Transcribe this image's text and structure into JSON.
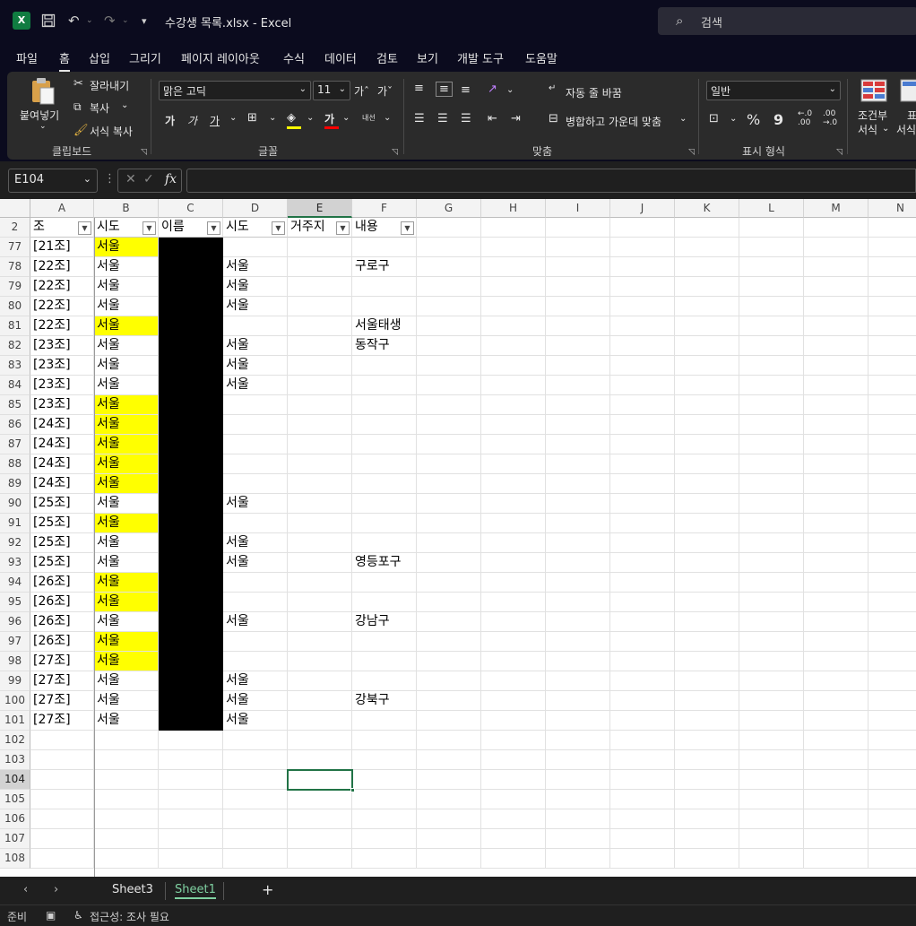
{
  "window": {
    "title": "수강생 목록.xlsx  -  Excel",
    "search_placeholder": "검색"
  },
  "menu": [
    "파일",
    "홈",
    "삽입",
    "그리기",
    "페이지 레이아웃",
    "수식",
    "데이터",
    "검토",
    "보기",
    "개발 도구",
    "도움말"
  ],
  "menu_active": "홈",
  "ribbon": {
    "clipboard": {
      "label": "클립보드",
      "paste": "붙여넣기",
      "cut": "잘라내기",
      "copy": "복사",
      "format_painter": "서식 복사"
    },
    "font": {
      "label": "글꼴",
      "font_name": "맑은 고딕",
      "font_size": "11",
      "grow": "가ˆ",
      "shrink": "가ˇ",
      "bold": "가",
      "italic": "가",
      "underline": "가",
      "font_color_glyph": "가",
      "phonetic": "내선"
    },
    "alignment": {
      "label": "맞춤",
      "wrap_text": "자동 줄 바꿈",
      "merge_center": "병합하고 가운데 맞춤"
    },
    "number": {
      "label": "표시 형식",
      "format": "일반",
      "percent": "%",
      "comma": "9",
      "inc_decimal": "←.0\n.00",
      "dec_decimal": ".00\n→.0"
    },
    "styles": {
      "conditional_line1": "조건부",
      "conditional_line2": "서식",
      "table_line1": "표",
      "table_line2": "서식"
    }
  },
  "formula_bar": {
    "name_box": "E104",
    "fx": "fx",
    "content": ""
  },
  "columns": [
    "A",
    "B",
    "C",
    "D",
    "E",
    "F",
    "G",
    "H",
    "I",
    "J",
    "K",
    "L",
    "M",
    "N"
  ],
  "selected_column": "E",
  "header_row": {
    "row_number": "2",
    "cells": [
      "조",
      "시도",
      "이름",
      "시도",
      "거주지",
      "내용"
    ]
  },
  "rows": [
    {
      "n": "77",
      "a": "[21조]",
      "b": "서울",
      "b_yellow": true,
      "d": "",
      "f": ""
    },
    {
      "n": "78",
      "a": "[22조]",
      "b": "서울",
      "b_yellow": false,
      "d": "서울",
      "f": "구로구"
    },
    {
      "n": "79",
      "a": "[22조]",
      "b": "서울",
      "b_yellow": false,
      "d": "서울",
      "f": ""
    },
    {
      "n": "80",
      "a": "[22조]",
      "b": "서울",
      "b_yellow": false,
      "d": "서울",
      "f": ""
    },
    {
      "n": "81",
      "a": "[22조]",
      "b": "서울",
      "b_yellow": true,
      "d": "",
      "f": "서울태생"
    },
    {
      "n": "82",
      "a": "[23조]",
      "b": "서울",
      "b_yellow": false,
      "d": "서울",
      "f": "동작구"
    },
    {
      "n": "83",
      "a": "[23조]",
      "b": "서울",
      "b_yellow": false,
      "d": "서울",
      "f": ""
    },
    {
      "n": "84",
      "a": "[23조]",
      "b": "서울",
      "b_yellow": false,
      "d": "서울",
      "f": ""
    },
    {
      "n": "85",
      "a": "[23조]",
      "b": "서울",
      "b_yellow": true,
      "d": "",
      "f": ""
    },
    {
      "n": "86",
      "a": "[24조]",
      "b": "서울",
      "b_yellow": true,
      "d": "",
      "f": ""
    },
    {
      "n": "87",
      "a": "[24조]",
      "b": "서울",
      "b_yellow": true,
      "d": "",
      "f": ""
    },
    {
      "n": "88",
      "a": "[24조]",
      "b": "서울",
      "b_yellow": true,
      "d": "",
      "f": ""
    },
    {
      "n": "89",
      "a": "[24조]",
      "b": "서울",
      "b_yellow": true,
      "d": "",
      "f": ""
    },
    {
      "n": "90",
      "a": "[25조]",
      "b": "서울",
      "b_yellow": false,
      "d": "서울",
      "f": ""
    },
    {
      "n": "91",
      "a": "[25조]",
      "b": "서울",
      "b_yellow": true,
      "d": "",
      "f": ""
    },
    {
      "n": "92",
      "a": "[25조]",
      "b": "서울",
      "b_yellow": false,
      "d": "서울",
      "f": ""
    },
    {
      "n": "93",
      "a": "[25조]",
      "b": "서울",
      "b_yellow": false,
      "d": "서울",
      "f": "영등포구"
    },
    {
      "n": "94",
      "a": "[26조]",
      "b": "서울",
      "b_yellow": true,
      "d": "",
      "f": ""
    },
    {
      "n": "95",
      "a": "[26조]",
      "b": "서울",
      "b_yellow": true,
      "d": "",
      "f": ""
    },
    {
      "n": "96",
      "a": "[26조]",
      "b": "서울",
      "b_yellow": false,
      "d": "서울",
      "f": "강남구"
    },
    {
      "n": "97",
      "a": "[26조]",
      "b": "서울",
      "b_yellow": true,
      "d": "",
      "f": ""
    },
    {
      "n": "98",
      "a": "[27조]",
      "b": "서울",
      "b_yellow": true,
      "d": "",
      "f": ""
    },
    {
      "n": "99",
      "a": "[27조]",
      "b": "서울",
      "b_yellow": false,
      "d": "서울",
      "f": ""
    },
    {
      "n": "100",
      "a": "[27조]",
      "b": "서울",
      "b_yellow": false,
      "d": "서울",
      "f": "강북구"
    },
    {
      "n": "101",
      "a": "[27조]",
      "b": "서울",
      "b_yellow": false,
      "d": "서울",
      "f": ""
    },
    {
      "n": "102",
      "a": "",
      "b": "",
      "b_yellow": false,
      "d": "",
      "f": ""
    },
    {
      "n": "103",
      "a": "",
      "b": "",
      "b_yellow": false,
      "d": "",
      "f": ""
    },
    {
      "n": "104",
      "a": "",
      "b": "",
      "b_yellow": false,
      "d": "",
      "f": ""
    },
    {
      "n": "105",
      "a": "",
      "b": "",
      "b_yellow": false,
      "d": "",
      "f": ""
    },
    {
      "n": "106",
      "a": "",
      "b": "",
      "b_yellow": false,
      "d": "",
      "f": ""
    },
    {
      "n": "107",
      "a": "",
      "b": "",
      "b_yellow": false,
      "d": "",
      "f": ""
    },
    {
      "n": "108",
      "a": "",
      "b": "",
      "b_yellow": false,
      "d": "",
      "f": ""
    }
  ],
  "redacted_column": "C",
  "redacted_last_row": "101",
  "active_cell": "E104",
  "colors": {
    "highlight": "#ffff00",
    "redaction": "#000000",
    "selection": "#217346",
    "active_tab": "#7fd0a1"
  },
  "sheet_tabs": [
    "Sheet3",
    "Sheet1"
  ],
  "active_sheet": "Sheet1",
  "status": {
    "ready": "준비",
    "accessibility": "접근성: 조사 필요"
  }
}
